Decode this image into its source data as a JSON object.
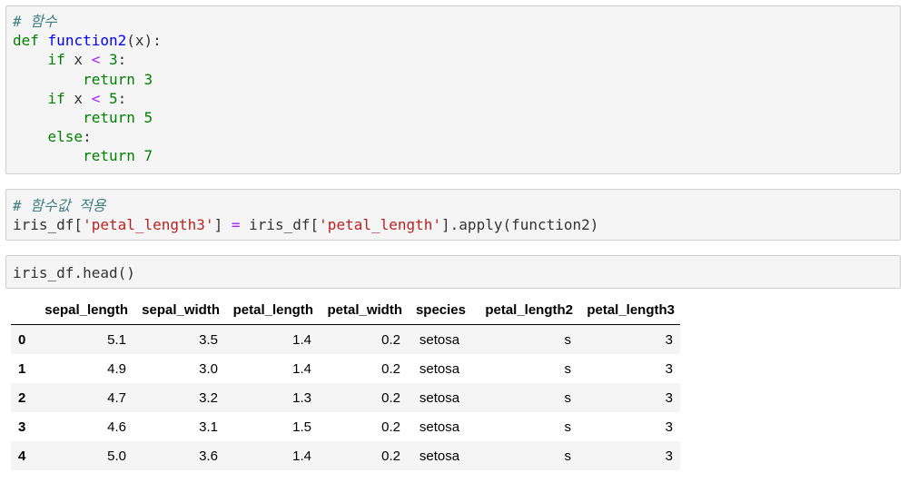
{
  "cells": [
    {
      "id": "function-def-cell",
      "lines": [
        [
          {
            "t": "# 함수",
            "k": "cm"
          }
        ],
        [
          {
            "t": "def",
            "k": "kw"
          },
          {
            "t": " ",
            "k": "tx"
          },
          {
            "t": "function2",
            "k": "fn"
          },
          {
            "t": "(x):",
            "k": "tx"
          }
        ],
        [
          {
            "t": "    ",
            "k": "tx"
          },
          {
            "t": "if",
            "k": "kw"
          },
          {
            "t": " x ",
            "k": "tx"
          },
          {
            "t": "<",
            "k": "op"
          },
          {
            "t": " ",
            "k": "tx"
          },
          {
            "t": "3",
            "k": "nm"
          },
          {
            "t": ":",
            "k": "tx"
          }
        ],
        [
          {
            "t": "        ",
            "k": "tx"
          },
          {
            "t": "return",
            "k": "kw"
          },
          {
            "t": " ",
            "k": "tx"
          },
          {
            "t": "3",
            "k": "nm"
          }
        ],
        [
          {
            "t": "    ",
            "k": "tx"
          },
          {
            "t": "if",
            "k": "kw"
          },
          {
            "t": " x ",
            "k": "tx"
          },
          {
            "t": "<",
            "k": "op"
          },
          {
            "t": " ",
            "k": "tx"
          },
          {
            "t": "5",
            "k": "nm"
          },
          {
            "t": ":",
            "k": "tx"
          }
        ],
        [
          {
            "t": "        ",
            "k": "tx"
          },
          {
            "t": "return",
            "k": "kw"
          },
          {
            "t": " ",
            "k": "tx"
          },
          {
            "t": "5",
            "k": "nm"
          }
        ],
        [
          {
            "t": "    ",
            "k": "tx"
          },
          {
            "t": "else",
            "k": "kw"
          },
          {
            "t": ":",
            "k": "tx"
          }
        ],
        [
          {
            "t": "        ",
            "k": "tx"
          },
          {
            "t": "return",
            "k": "kw"
          },
          {
            "t": " ",
            "k": "tx"
          },
          {
            "t": "7",
            "k": "nm"
          }
        ]
      ]
    },
    {
      "id": "apply-cell",
      "lines": [
        [
          {
            "t": "# 함수값 적용",
            "k": "cm"
          }
        ],
        [
          {
            "t": "iris_df[",
            "k": "tx"
          },
          {
            "t": "'petal_length3'",
            "k": "st"
          },
          {
            "t": "] ",
            "k": "tx"
          },
          {
            "t": "=",
            "k": "op"
          },
          {
            "t": " iris_df[",
            "k": "tx"
          },
          {
            "t": "'petal_length'",
            "k": "st"
          },
          {
            "t": "].apply(function2)",
            "k": "tx"
          }
        ]
      ]
    },
    {
      "id": "head-cell",
      "lines": [
        [
          {
            "t": "iris_df.head()",
            "k": "tx"
          }
        ]
      ]
    }
  ],
  "table": {
    "index_header": "",
    "columns": [
      "sepal_length",
      "sepal_width",
      "petal_length",
      "petal_width",
      "species",
      "petal_length2",
      "petal_length3"
    ],
    "rows": [
      {
        "index": "0",
        "values": [
          "5.1",
          "3.5",
          "1.4",
          "0.2",
          "setosa",
          "s",
          "3"
        ]
      },
      {
        "index": "1",
        "values": [
          "4.9",
          "3.0",
          "1.4",
          "0.2",
          "setosa",
          "s",
          "3"
        ]
      },
      {
        "index": "2",
        "values": [
          "4.7",
          "3.2",
          "1.3",
          "0.2",
          "setosa",
          "s",
          "3"
        ]
      },
      {
        "index": "3",
        "values": [
          "4.6",
          "3.1",
          "1.5",
          "0.2",
          "setosa",
          "s",
          "3"
        ]
      },
      {
        "index": "4",
        "values": [
          "5.0",
          "3.6",
          "1.4",
          "0.2",
          "setosa",
          "s",
          "3"
        ]
      }
    ]
  },
  "colors": {
    "cell_background": "#f5f5f5",
    "cell_border": "#cfcfcf",
    "comment": "#408080",
    "keyword": "#008000",
    "function_name": "#0000ff",
    "number": "#008000",
    "operator": "#aa22ff",
    "string": "#ba2121"
  }
}
